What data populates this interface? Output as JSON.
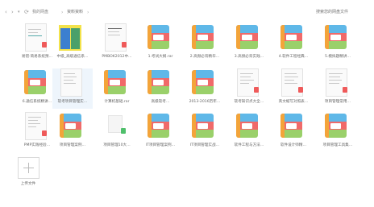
{
  "nav": {
    "back": "‹",
    "forward": "›",
    "dropdown": "▾",
    "refresh": "⟳",
    "breadcrumb": [
      "我的网盘",
      "资料资料"
    ],
    "search_placeholder": "搜索您的网盘文件"
  },
  "items": [
    {
      "label": "易错·简易系统预…",
      "icon": "doc-thumb-pdf"
    },
    {
      "label": "中级_高级通信系…",
      "icon": "book-cover"
    },
    {
      "label": "PMBOK2012中…",
      "icon": "doc-thumb"
    },
    {
      "label": "1.考试大纲.rar",
      "icon": "archive-icon"
    },
    {
      "label": "2.高频必背精华…",
      "icon": "archive-icon"
    },
    {
      "label": "3.高频必背实践…",
      "icon": "archive-icon"
    },
    {
      "label": "4.软件工程经典…",
      "icon": "archive-icon"
    },
    {
      "label": "5.模拟题精讲…",
      "icon": "archive-icon"
    },
    {
      "label": "6.通信系统精讲…",
      "icon": "archive-icon"
    },
    {
      "label": "软考项目管理实…",
      "icon": "doc-thumb-selected"
    },
    {
      "label": "计算机基础.rar",
      "icon": "archive-icon"
    },
    {
      "label": "高级软考…",
      "icon": "archive-icon"
    },
    {
      "label": "2013-2016历年…",
      "icon": "archive-icon"
    },
    {
      "label": "软考知识点大全…",
      "icon": "doc-thumb-pdf"
    },
    {
      "label": "英文缩写对照表…",
      "icon": "doc-thumb-pdf"
    },
    {
      "label": "项目管理常用…",
      "icon": "doc-thumb-pdf"
    },
    {
      "label": "PMP实践经验…",
      "icon": "doc-thumb-pdf"
    },
    {
      "label": "项目管理案例…",
      "icon": "archive-icon"
    },
    {
      "label": "项目管理10大…",
      "icon": "doc-blank-green"
    },
    {
      "label": "IT项目管理案例…",
      "icon": "archive-icon"
    },
    {
      "label": "IT项目管理实战…",
      "icon": "archive-icon"
    },
    {
      "label": "软件工程与方法…",
      "icon": "archive-icon"
    },
    {
      "label": "软件设计师精…",
      "icon": "archive-icon"
    },
    {
      "label": "项目管理工具集…",
      "icon": "archive-icon"
    }
  ],
  "upload": {
    "label": "上传文件",
    "icon": "plus-icon"
  }
}
